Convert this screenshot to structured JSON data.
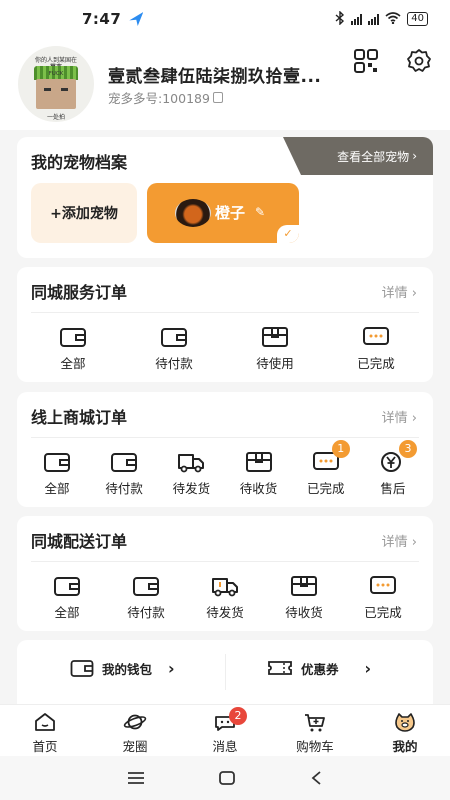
{
  "status_bar": {
    "time": "7:47",
    "battery": "40"
  },
  "profile": {
    "avatar_lines": [
      "你的人到某国在",
      "草奋",
      "FUCK",
      "一处拍"
    ],
    "username": "壹贰叁肆伍陆柒捌玖拾壹...",
    "pet_id": "宠多多号:100189"
  },
  "pets": {
    "title": "我的宠物档案",
    "view_all": "查看全部宠物",
    "add_label": "+添加宠物",
    "pet_name": "橙子"
  },
  "service_orders": {
    "title": "同城服务订单",
    "more": "详情",
    "items": [
      {
        "label": "全部",
        "icon": "wallet-icon"
      },
      {
        "label": "待付款",
        "icon": "wallet-icon"
      },
      {
        "label": "待使用",
        "icon": "box-icon"
      },
      {
        "label": "已完成",
        "icon": "chat-icon"
      }
    ]
  },
  "mall_orders": {
    "title": "线上商城订单",
    "more": "详情",
    "items": [
      {
        "label": "全部",
        "icon": "wallet-icon"
      },
      {
        "label": "待付款",
        "icon": "wallet-icon"
      },
      {
        "label": "待发货",
        "icon": "truck-icon"
      },
      {
        "label": "待收货",
        "icon": "box-icon"
      },
      {
        "label": "已完成",
        "icon": "chat-icon",
        "badge": "1"
      },
      {
        "label": "售后",
        "icon": "yen-icon",
        "badge": "3"
      }
    ]
  },
  "delivery_orders": {
    "title": "同城配送订单",
    "more": "详情",
    "items": [
      {
        "label": "全部",
        "icon": "wallet-icon"
      },
      {
        "label": "待付款",
        "icon": "wallet-icon"
      },
      {
        "label": "待发货",
        "icon": "truck-icon"
      },
      {
        "label": "待收货",
        "icon": "box-icon"
      },
      {
        "label": "已完成",
        "icon": "chat-icon"
      }
    ]
  },
  "wallet": {
    "wallet_label": "我的钱包",
    "coupon_label": "优惠券"
  },
  "tabbar": {
    "items": [
      {
        "label": "首页",
        "icon": "home-icon"
      },
      {
        "label": "宠圈",
        "icon": "planet-icon"
      },
      {
        "label": "消息",
        "icon": "message-icon",
        "badge": "2"
      },
      {
        "label": "购物车",
        "icon": "cart-icon"
      },
      {
        "label": "我的",
        "icon": "pig-icon"
      }
    ]
  },
  "colors": {
    "accent": "#f39b32",
    "tab_dark": "#6e6a63",
    "badge_red": "#e8473b"
  }
}
